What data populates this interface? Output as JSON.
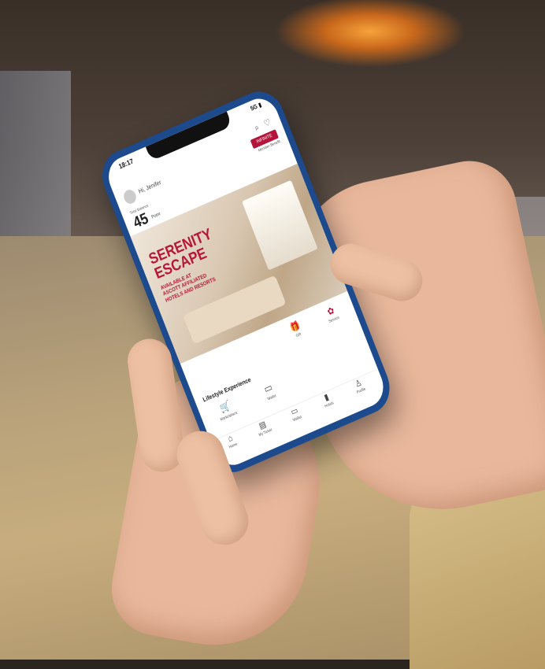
{
  "app": {
    "status_time": "18:17",
    "status_right": "5G ▮",
    "greeting": "Hi, Jenifer",
    "header_icons": "⌕ ♡",
    "points_button": "INFINITE",
    "member_link": "Member Benefit",
    "balance_label": "Total Balance",
    "points_value": "45",
    "points_unit": "Point"
  },
  "banner": {
    "title_line1": "SERENITY",
    "title_line2": "ESCAPE",
    "subtitle_line1": "AVAILABLE AT",
    "subtitle_line2": "ASCOTT AFFILIATED",
    "subtitle_line3": "HOTELS AND RESORTS"
  },
  "quick_actions": [
    {
      "icon": "gift-icon",
      "label": "Gift"
    },
    {
      "icon": "service-icon",
      "label": "Service"
    }
  ],
  "lifestyle": {
    "title": "Lifestyle Experience",
    "items": [
      {
        "icon": "cart-icon",
        "label": "Marketplace"
      },
      {
        "icon": "wallet-icon",
        "label": "Wallet"
      }
    ]
  },
  "tabbar": [
    {
      "icon": "home-icon",
      "label": "Home"
    },
    {
      "icon": "ticket-icon",
      "label": "My Ticket"
    },
    {
      "icon": "wallet-icon",
      "label": "Wallet"
    },
    {
      "icon": "tower-icon",
      "label": "Hotels"
    },
    {
      "icon": "profile-icon",
      "label": "Profile"
    }
  ]
}
